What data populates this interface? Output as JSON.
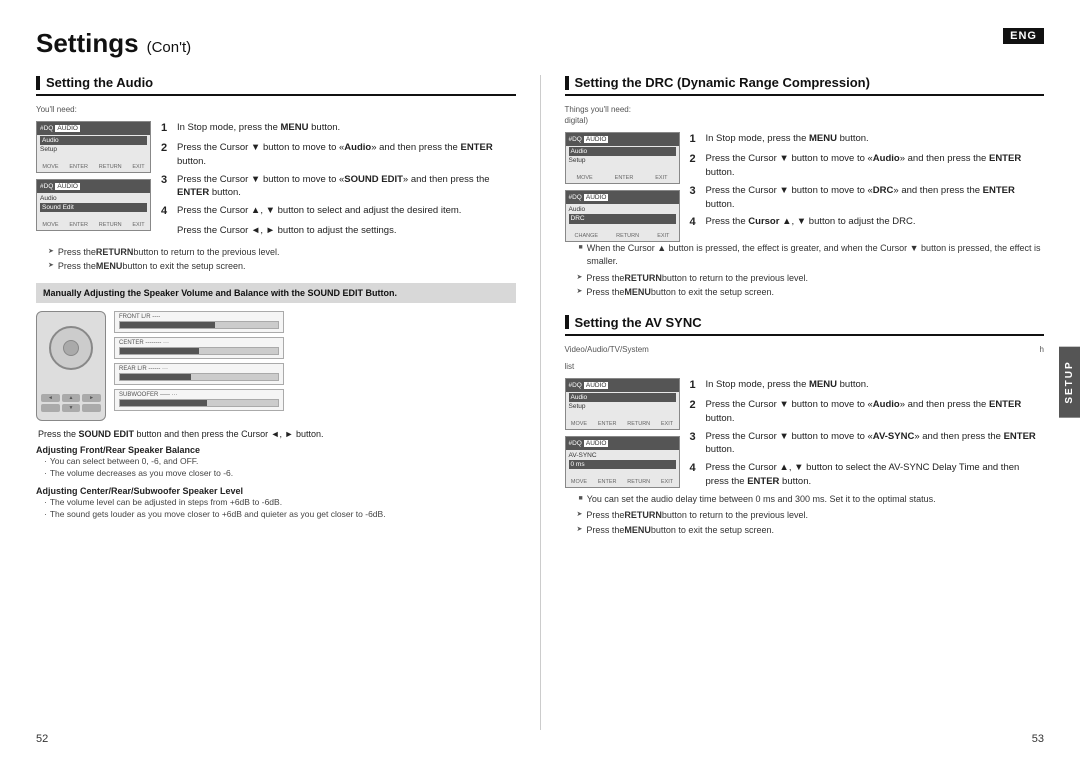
{
  "header": {
    "title": "Settings",
    "cont": "(Con't)",
    "eng": "ENG"
  },
  "left_column": {
    "section_title": "Setting the Audio",
    "sub_label": "You'll need:",
    "steps": [
      {
        "num": "1",
        "text": "In Stop mode, press the ",
        "bold": "MENU",
        "text2": " button."
      },
      {
        "num": "2",
        "text": "Press the Cursor ▼ button to move to «Audio» and then press the ",
        "bold": "ENTER",
        "text2": " button."
      },
      {
        "num": "3",
        "text": "Press the Cursor ▼ button to move to «SOUND EDIT» and then press the ",
        "bold": "ENTER",
        "text2": " button."
      },
      {
        "num": "4",
        "text": "Press the Cursor ▲, ▼ button to select and adjust the desired item."
      },
      {
        "num": "",
        "text": "Press the Cursor ◄, ► button to adjust the settings."
      }
    ],
    "arrow_bullets": [
      "Press the RETURN button to return to the previous level.",
      "Press the MENU button to exit the setup screen."
    ],
    "manual_box": {
      "title": "Manually Adjusting the Speaker Volume and Balance with the SOUND EDIT Button.",
      "text": "Press the SOUND EDIT button and then press the Cursor ◄, ► button."
    },
    "adj_sections": [
      {
        "title": "Adjusting Front/Rear Speaker Balance",
        "bullets": [
          "You can select between 0, -6, and OFF.",
          "The volume decreases as you move closer to -6."
        ]
      },
      {
        "title": "Adjusting Center/Rear/Subwoofer Speaker Level",
        "bullets": [
          "The volume level can be adjusted in steps from +6dB to -6dB.",
          "The sound gets louder as you move closer to +6dB and quieter as you get closer to -6dB."
        ]
      }
    ]
  },
  "right_column": {
    "drc_section": {
      "title": "Setting the DRC (Dynamic Range Compression)",
      "sub_label_line1": "Things you'll need:",
      "sub_label_line2": "digital)",
      "steps": [
        {
          "num": "1",
          "text": "In Stop mode, press the ",
          "bold": "MENU",
          "text2": " button."
        },
        {
          "num": "2",
          "text": "Press the Cursor ▼ button to move to «Audio» and then press the ",
          "bold": "ENTER",
          "text2": " button."
        },
        {
          "num": "3",
          "text": "Press the Cursor ▼ button to move to «DRC» and then press the ",
          "bold": "ENTER",
          "text2": " button."
        },
        {
          "num": "4",
          "text": "Press the Cursor ▲, ▼ button to adjust the DRC."
        }
      ],
      "note": "When the Cursor ▲ button is pressed, the effect is greater, and when the Cursor ▼ button is pressed, the effect is smaller.",
      "arrow_bullets": [
        "Press the RETURN button to return to the previous level.",
        "Press the MENU button to exit the setup screen."
      ]
    },
    "av_sync_section": {
      "title": "Setting the AV SYNC",
      "sub_label": "Video/Audio/TV/System",
      "sub_label2": "h",
      "sub_label3": "list",
      "steps": [
        {
          "num": "1",
          "text": "In Stop mode, press the ",
          "bold": "MENU",
          "text2": " button."
        },
        {
          "num": "2",
          "text": "Press the Cursor ▼ button to move to «Audio» and then press the ",
          "bold": "ENTER",
          "text2": " button."
        },
        {
          "num": "3",
          "text": "Press the Cursor ▼ button to move to «AV-SYNC» and then press the ",
          "bold": "ENTER",
          "text2": " button."
        },
        {
          "num": "4",
          "text": "Press the Cursor ▲, ▼ button to select the AV-SYNC Delay Time and then press the ",
          "bold": "ENTER",
          "text2": " button."
        }
      ],
      "note": "You can set the audio delay time between 0 ms and 300 ms. Set it to the optimal status.",
      "arrow_bullets": [
        "Press the RETURN button to return to the previous level.",
        "Press the MENU button to exit the setup screen."
      ]
    }
  },
  "page_numbers": {
    "left": "52",
    "right": "53"
  },
  "setup_tab": "SETUP"
}
